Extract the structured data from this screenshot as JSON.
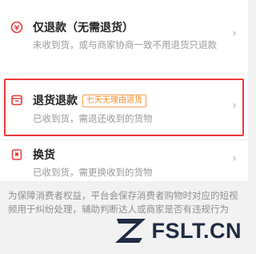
{
  "options": [
    {
      "title": "仅退款（无需退货）",
      "desc": "未收到货，或与商家协商一致不用退货只退款",
      "icon": "refund-icon"
    },
    {
      "title": "退货退款",
      "tag": "七天无理由退货",
      "desc": "已收到货，需退还收到的货物",
      "icon": "return-box-icon"
    },
    {
      "title": "换货",
      "desc": "已收到货，需更换收到的货物",
      "icon": "exchange-icon"
    }
  ],
  "notice": "为保障消费者权益，平台会保存消费者购物时对应的短视频用于纠纷处理，辅助判断达人或商家是否有违规行为",
  "watermark": "FSLT.CN",
  "colors": {
    "accent": "#ee3b3b",
    "tag": "#f08a24",
    "watermark": "#1f2b44"
  }
}
